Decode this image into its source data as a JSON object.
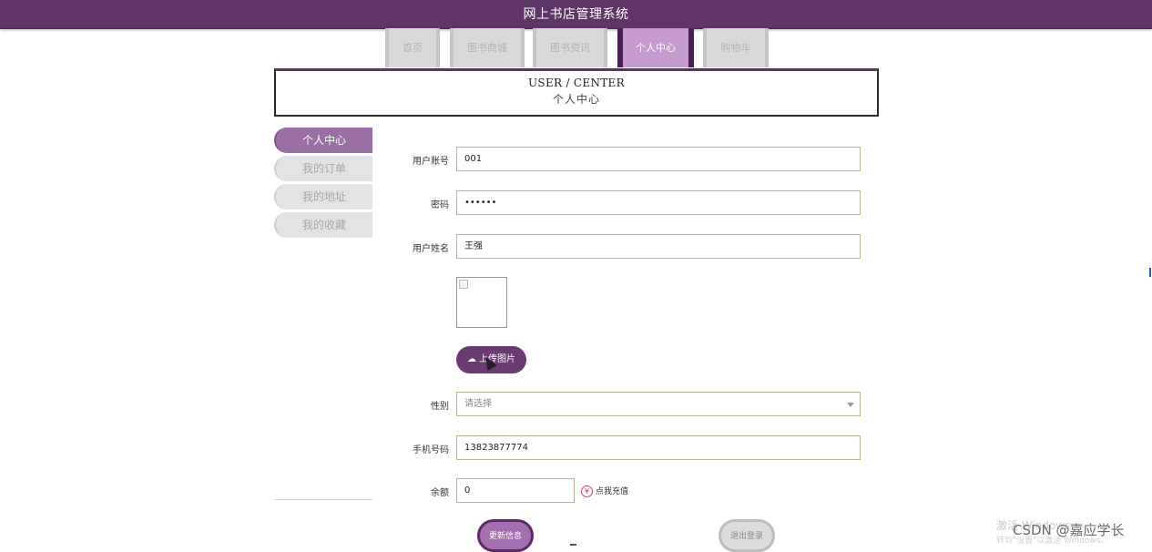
{
  "app": {
    "title": "网上书店管理系统"
  },
  "nav": {
    "tabs": [
      {
        "label": "首页"
      },
      {
        "label": "图书商城"
      },
      {
        "label": "图书资讯"
      },
      {
        "label": "个人中心"
      },
      {
        "label": "购物车"
      }
    ],
    "active": "个人中心"
  },
  "header": {
    "en": "USER / CENTER",
    "cn": "个人中心"
  },
  "sidebar": {
    "items": [
      {
        "label": "个人中心"
      },
      {
        "label": "我的订单"
      },
      {
        "label": "我的地址"
      },
      {
        "label": "我的收藏"
      }
    ],
    "active": "个人中心"
  },
  "form": {
    "account": {
      "label": "用户账号",
      "value": "001"
    },
    "password": {
      "label": "密码",
      "value": "••••••"
    },
    "name": {
      "label": "用户姓名",
      "value": "王强"
    },
    "upload_label": "上传图片",
    "gender": {
      "label": "性别",
      "placeholder": "请选择"
    },
    "phone": {
      "label": "手机号码",
      "value": "13823877774"
    },
    "balance": {
      "label": "余额",
      "value": "0"
    },
    "recharge_label": "点我充值",
    "update_label": "更新信息",
    "logout_label": "退出登录"
  },
  "overlay": {
    "activate_line1": "激活 Windows",
    "activate_line2": "转到\"设置\"以激活 Windows。",
    "csdn": "CSDN @嘉应学长"
  },
  "colors": {
    "brand": "#5e3566",
    "active_tab": "#c69bd0",
    "side_active": "#9a6fa5",
    "upload_button": "#6b3a72"
  },
  "icons": {
    "upload": "cloud-upload-icon",
    "recharge": "yen-icon",
    "select": "chevron-down-icon"
  }
}
